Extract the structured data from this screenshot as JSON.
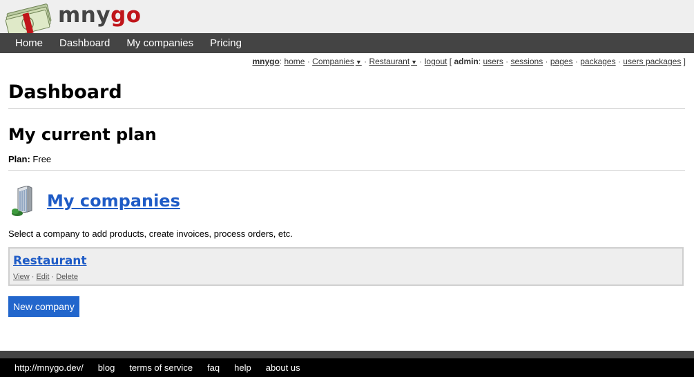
{
  "brand": {
    "name_part1": "mny",
    "name_part2": "go",
    "accent_color": "#c0151a"
  },
  "nav": {
    "items": [
      "Home",
      "Dashboard",
      "My companies",
      "Pricing"
    ]
  },
  "adminbar": {
    "brand": "mnygo",
    "home": "home",
    "companies": "Companies",
    "restaurant": "Restaurant",
    "logout": "logout",
    "admin_label": "admin",
    "users": "users",
    "sessions": "sessions",
    "pages": "pages",
    "packages": "packages",
    "users_packages": "users packages"
  },
  "main": {
    "title": "Dashboard",
    "plan_heading": "My current plan",
    "plan_label": "Plan:",
    "plan_value": "Free",
    "companies_heading": "My companies",
    "hint": "Select a company to add products, create invoices, process orders, etc.",
    "companies": [
      {
        "name": "Restaurant",
        "actions": [
          "View",
          "Edit",
          "Delete"
        ]
      }
    ],
    "new_company_label": "New company"
  },
  "footer": {
    "links": [
      "http://mnygo.dev/",
      "blog",
      "terms of service",
      "faq",
      "help",
      "about us"
    ]
  },
  "colors": {
    "nav_bg": "#444444",
    "link": "#1e5bc6",
    "button": "#2266cc"
  }
}
